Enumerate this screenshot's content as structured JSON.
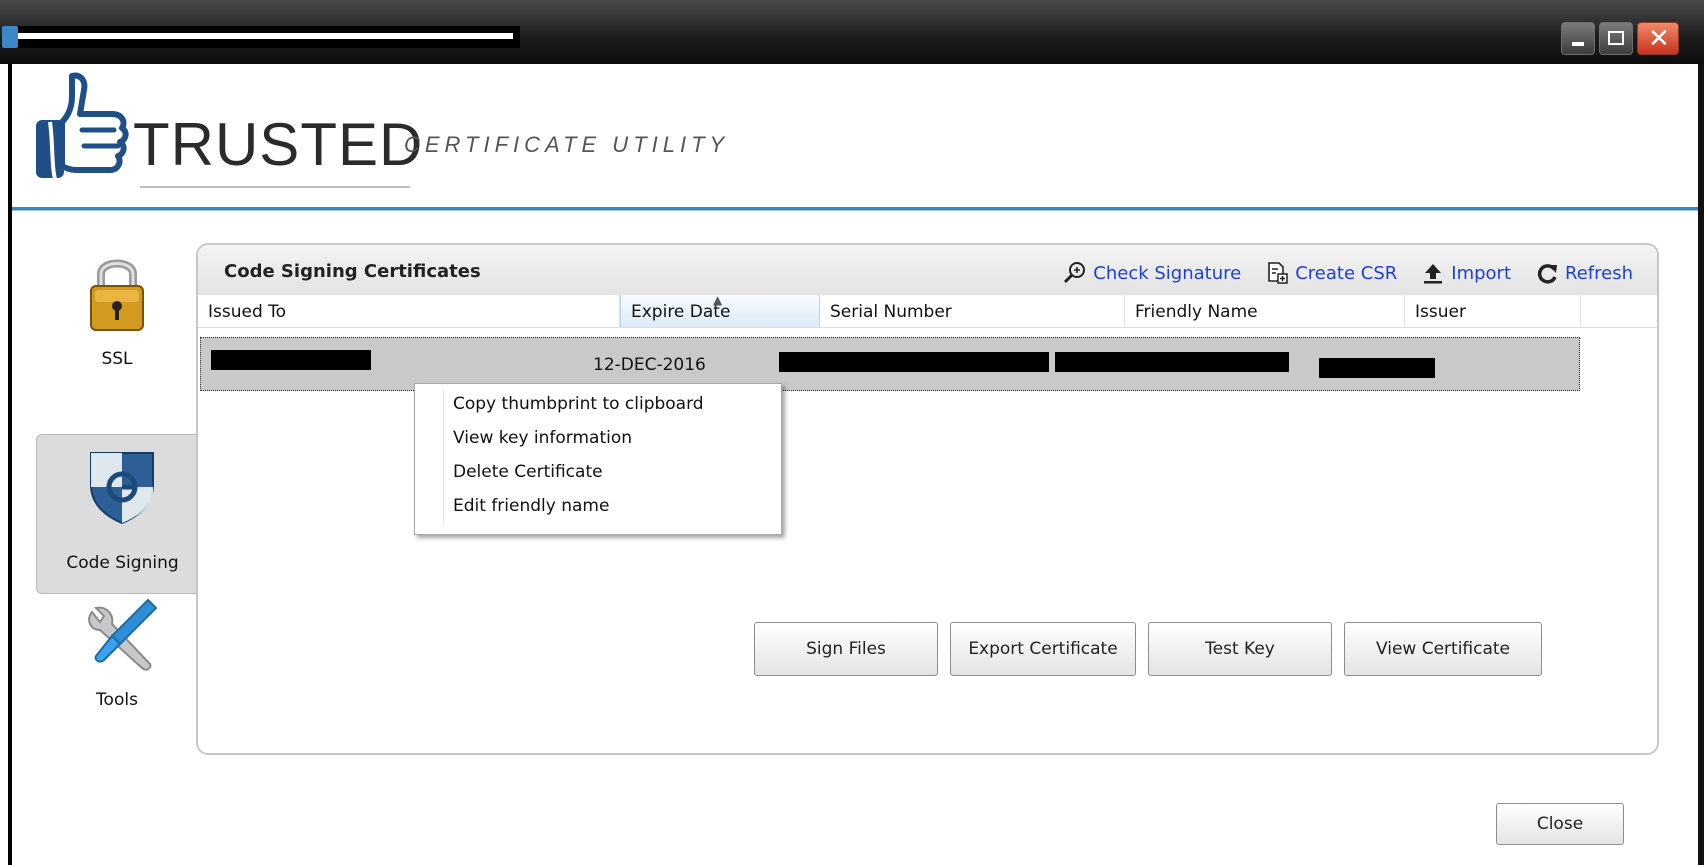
{
  "header": {
    "brand": "TRUSTED",
    "subtitle": "CERTIFICATE UTILITY"
  },
  "nav": {
    "items": [
      {
        "label": "SSL",
        "icon": "padlock-icon"
      },
      {
        "label": "Code Signing",
        "icon": "shield-icon",
        "selected": true
      },
      {
        "label": "Tools",
        "icon": "tools-icon"
      }
    ]
  },
  "panel": {
    "title": "Code Signing Certificates",
    "toolbar": {
      "check_signature": "Check Signature",
      "create_csr": "Create CSR",
      "import": "Import",
      "refresh": "Refresh"
    },
    "columns": [
      "Issued To",
      "Expire Date",
      "Serial Number",
      "Friendly Name",
      "Issuer"
    ],
    "rows": [
      {
        "expire_date": "12-DEC-2016"
      }
    ],
    "buttons": {
      "sign_files": "Sign Files",
      "export_certificate": "Export Certificate",
      "test_key": "Test Key",
      "view_certificate": "View Certificate"
    }
  },
  "context_menu": {
    "items": [
      "Copy thumbprint to clipboard",
      "View key information",
      "Delete Certificate",
      "Edit friendly name"
    ]
  },
  "footer": {
    "close": "Close"
  },
  "colors": {
    "link": "#1a3fd6",
    "accent": "#3d86c6",
    "close_button": "#d9442a"
  }
}
